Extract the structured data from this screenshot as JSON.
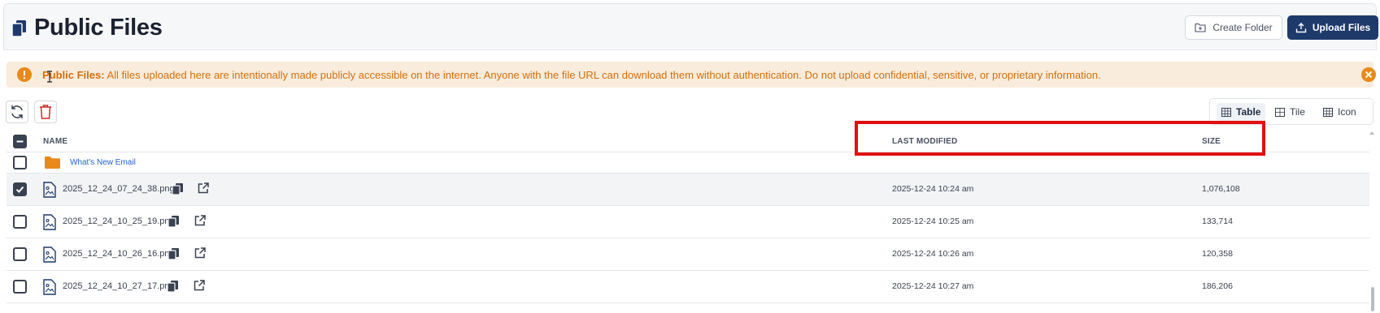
{
  "header": {
    "title": "Public Files",
    "title_icon": "copy-files-icon",
    "create_folder_label": "Create Folder",
    "upload_files_label": "Upload Files"
  },
  "banner": {
    "strong": "Public Files:",
    "message": " All files uploaded here are intentionally made publicly accessible on the internet. Anyone with the file URL can download them without authentication. Do not upload confidential, sensitive, or proprietary information.",
    "color": "#d5700e",
    "background": "#f9ecdc"
  },
  "toolbar": {
    "refresh_icon": "refresh-icon",
    "delete_icon": "trash-icon"
  },
  "view_switch": {
    "options": [
      "Table",
      "Tile",
      "Icon"
    ],
    "selected": "Table"
  },
  "table": {
    "headers": {
      "name": "NAME",
      "last_modified": "LAST MODIFIED",
      "size": "SIZE"
    },
    "folder": {
      "name": "What's New Email",
      "checked": false
    },
    "rows": [
      {
        "name": "2025_12_24_07_24_38.png",
        "modified": "2025-12-24 10:24 am",
        "size": "1,076,108",
        "checked": true
      },
      {
        "name": "2025_12_24_10_25_19.png",
        "modified": "2025-12-24 10:25 am",
        "size": "133,714",
        "checked": false
      },
      {
        "name": "2025_12_24_10_26_16.png",
        "modified": "2025-12-24 10:26 am",
        "size": "120,358",
        "checked": false
      },
      {
        "name": "2025_12_24_10_27_17.png",
        "modified": "2025-12-24 10:27 am",
        "size": "186,206",
        "checked": false
      }
    ]
  },
  "colors": {
    "primary": "#1e3a6b",
    "folder": "#e8891a",
    "link": "#2363d1",
    "highlight": "#e01010"
  }
}
